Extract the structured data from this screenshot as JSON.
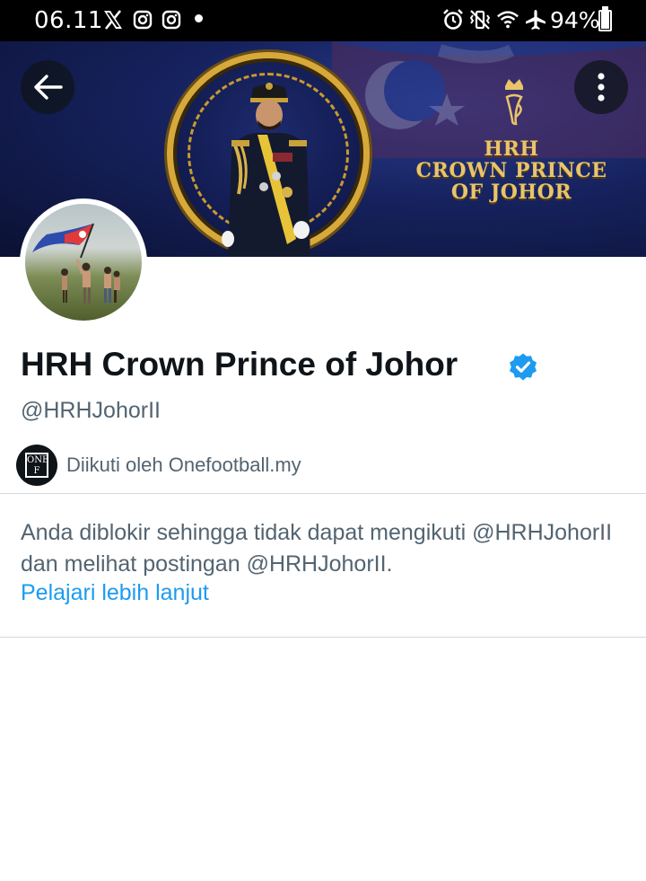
{
  "status_bar": {
    "time": "06.11",
    "notification_icons": [
      "x-logo-icon",
      "instagram-icon",
      "instagram-icon",
      "more-notifications-dot"
    ],
    "system_icons": [
      "alarm-icon",
      "vibrate-icon",
      "wifi-icon",
      "airplane-icon"
    ],
    "battery": "94%",
    "battery_level": 0.94
  },
  "header": {
    "back_icon": "back-arrow-icon",
    "more_icon": "more-vertical-icon",
    "banner_title_line1": "HRH",
    "banner_title_line2": "CROWN PRINCE",
    "banner_title_line3": "OF JOHOR"
  },
  "profile": {
    "name": "HRH Crown Prince of Johor",
    "verified": true,
    "handle": "@HRHJohorII",
    "followed_by_avatar_text": "ONE F",
    "followed_by": "Diikuti oleh Onefootball.my"
  },
  "blocked_notice": {
    "text": "Anda diblokir sehingga tidak dapat mengikuti @HRHJohorII dan melihat postingan @HRHJohorII.",
    "link": "Pelajari lebih lanjut"
  },
  "colors": {
    "accent": "#1d9bf0",
    "secondary_text": "#536471",
    "primary_text": "#0f1419",
    "banner_gold": "#e9c46a"
  }
}
